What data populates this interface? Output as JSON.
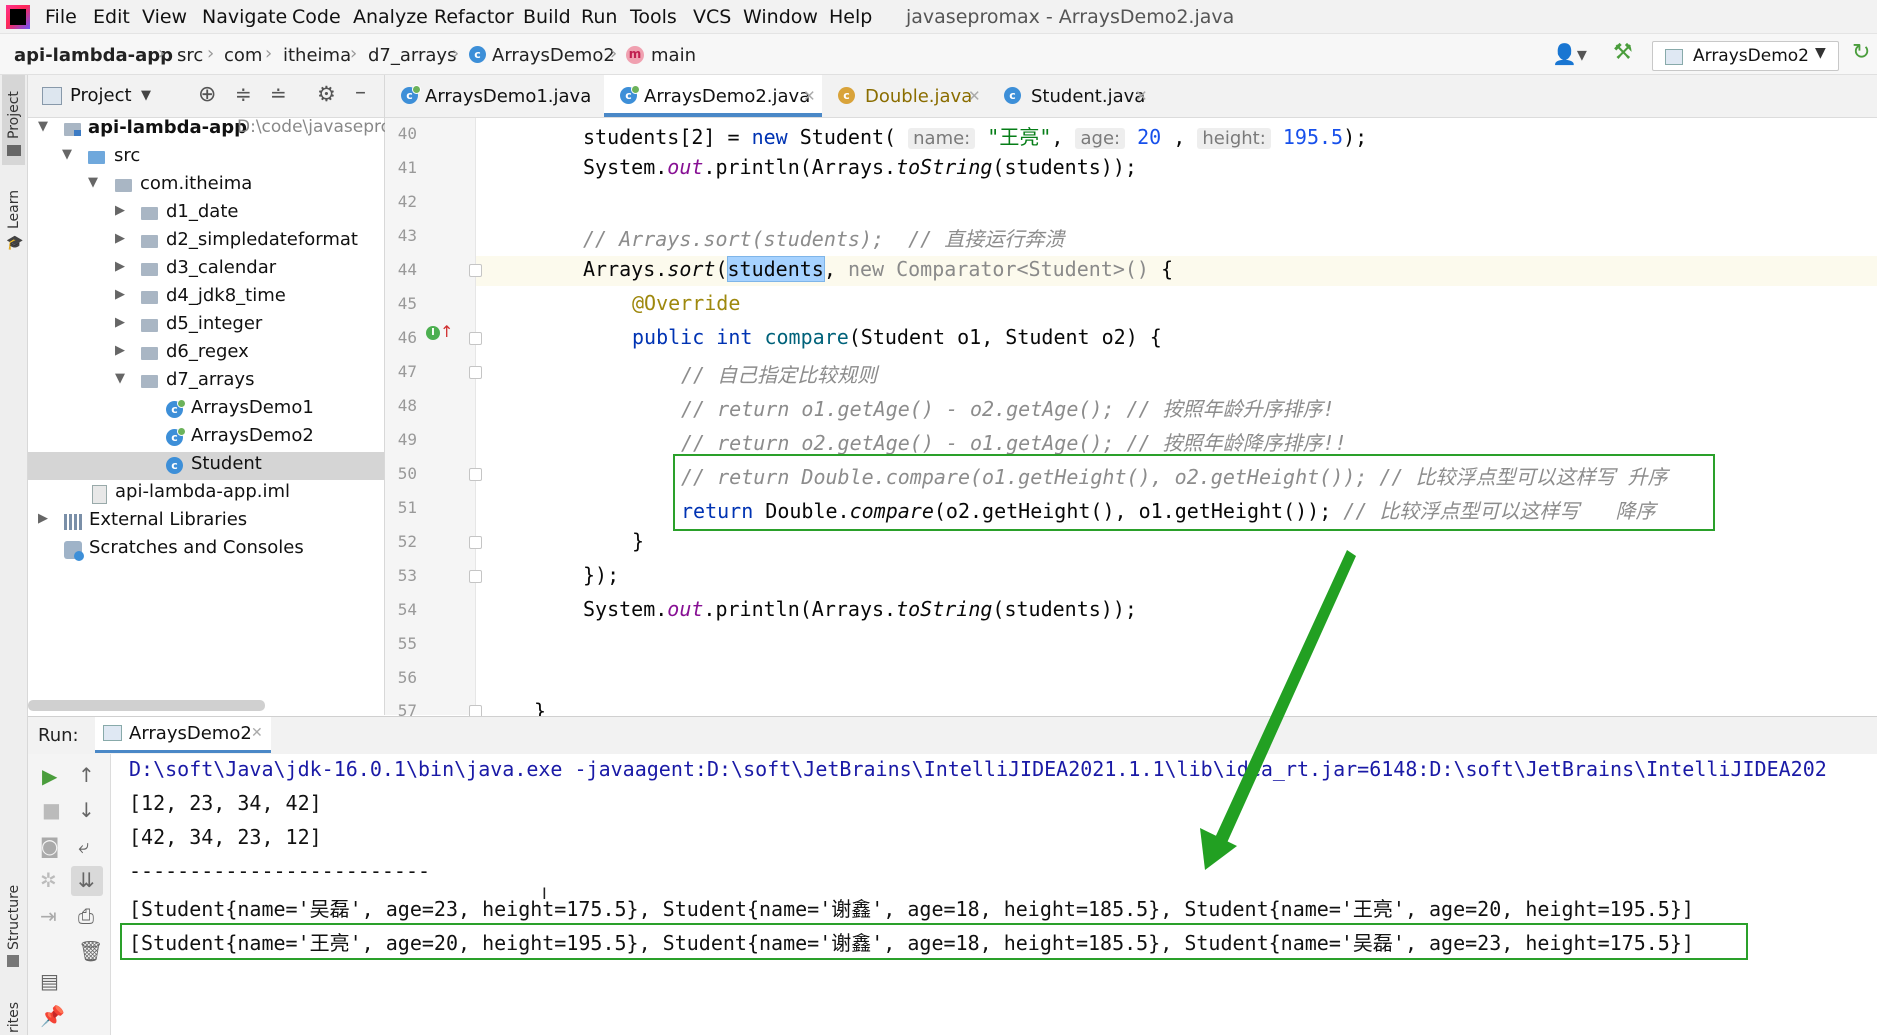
{
  "menu": {
    "items": [
      "File",
      "Edit",
      "View",
      "Navigate",
      "Code",
      "Analyze",
      "Refactor",
      "Build",
      "Run",
      "Tools",
      "VCS",
      "Window",
      "Help"
    ],
    "window_title": "javasepromax - ArraysDemo2.java"
  },
  "breadcrumb": {
    "project": "api-lambda-app",
    "parts": [
      "src",
      "com",
      "itheima",
      "d7_arrays",
      "ArraysDemo2",
      "main"
    ]
  },
  "run_config": {
    "label": "ArraysDemo2"
  },
  "tool_strip": {
    "project": "Project",
    "learn": "Learn",
    "structure": "Structure",
    "favorites": "rites"
  },
  "project_panel": {
    "title": "Project",
    "tree": {
      "root_name": "api-lambda-app",
      "root_path": "D:\\code\\javasepro",
      "src": "src",
      "pkg": "com.itheima",
      "folders": [
        "d1_date",
        "d2_simpledateformat",
        "d3_calendar",
        "d4_jdk8_time",
        "d5_integer",
        "d6_regex",
        "d7_arrays"
      ],
      "classes": [
        "ArraysDemo1",
        "ArraysDemo2",
        "Student"
      ],
      "iml": "api-lambda-app.iml",
      "libraries": "External Libraries",
      "scratches": "Scratches and Consoles"
    }
  },
  "tabs": [
    "ArraysDemo1.java",
    "ArraysDemo2.java",
    "Double.java",
    "Student.java"
  ],
  "editor": {
    "line_numbers": [
      "40",
      "41",
      "42",
      "43",
      "44",
      "45",
      "46",
      "47",
      "48",
      "49",
      "50",
      "51",
      "52",
      "53",
      "54",
      "55",
      "56",
      "57"
    ],
    "l40": {
      "a": "students[2] = ",
      "kw": "new",
      "b": " Student( ",
      "h1": "name:",
      "s1": "\"王亮\"",
      "c1": ", ",
      "h2": "age:",
      "n1": "20",
      "c2": " , ",
      "h3": "height:",
      "n2": "195.5",
      "e": ");"
    },
    "l41": {
      "a": "System.",
      "f": "out",
      "b": ".println(Arrays.",
      "m": "toString",
      "c": "(students));"
    },
    "l43": "// Arrays.sort(students);  // 直接运行奔溃",
    "l44": {
      "a": "Arrays.",
      "m": "sort",
      "b": "(",
      "sel": "students",
      "c": ", ",
      "g": "new Comparator<Student>()",
      "d": " {"
    },
    "l45": "@Override",
    "l46": {
      "kw1": "public",
      "kw2": "int",
      "name": "compare",
      "rest": "(Student o1, Student o2) {"
    },
    "l47": "// 自己指定比较规则",
    "l48": "// return o1.getAge() - o2.getAge(); // 按照年龄升序排序!",
    "l49": "// return o2.getAge() - o1.getAge(); // 按照年龄降序排序!!",
    "l50": "// return Double.compare(o1.getHeight(), o2.getHeight()); // 比较浮点型可以这样写 升序",
    "l51": {
      "kw": "return",
      "a": " Double.",
      "m": "compare",
      "b": "(o2.getHeight(), o1.getHeight()); ",
      "cm": "// 比较浮点型可以这样写   降序"
    },
    "l52": "}",
    "l53": "});",
    "l54": {
      "a": "System.",
      "f": "out",
      "b": ".println(Arrays.",
      "m": "toString",
      "c": "(students));"
    },
    "l57": "}"
  },
  "run_panel": {
    "label": "Run:",
    "tab": "ArraysDemo2",
    "console": [
      "D:\\soft\\Java\\jdk-16.0.1\\bin\\java.exe -javaagent:D:\\soft\\JetBrains\\IntelliJIDEA2021.1.1\\lib\\idea_rt.jar=6148:D:\\soft\\JetBrains\\IntelliJIDEA202",
      "[12, 23, 34, 42]",
      "[42, 34, 23, 12]",
      "-------------------------",
      "[Student{name='吴磊', age=23, height=175.5}, Student{name='谢鑫', age=18, height=185.5}, Student{name='王亮', age=20, height=195.5}]",
      "[Student{name='王亮', age=20, height=195.5}, Student{name='谢鑫', age=18, height=185.5}, Student{name='吴磊', age=23, height=175.5}]"
    ]
  },
  "colors": {
    "highlight_box": "#2aa02a",
    "arrow": "#22a022",
    "keyword": "#0033b3",
    "string": "#067d17"
  }
}
